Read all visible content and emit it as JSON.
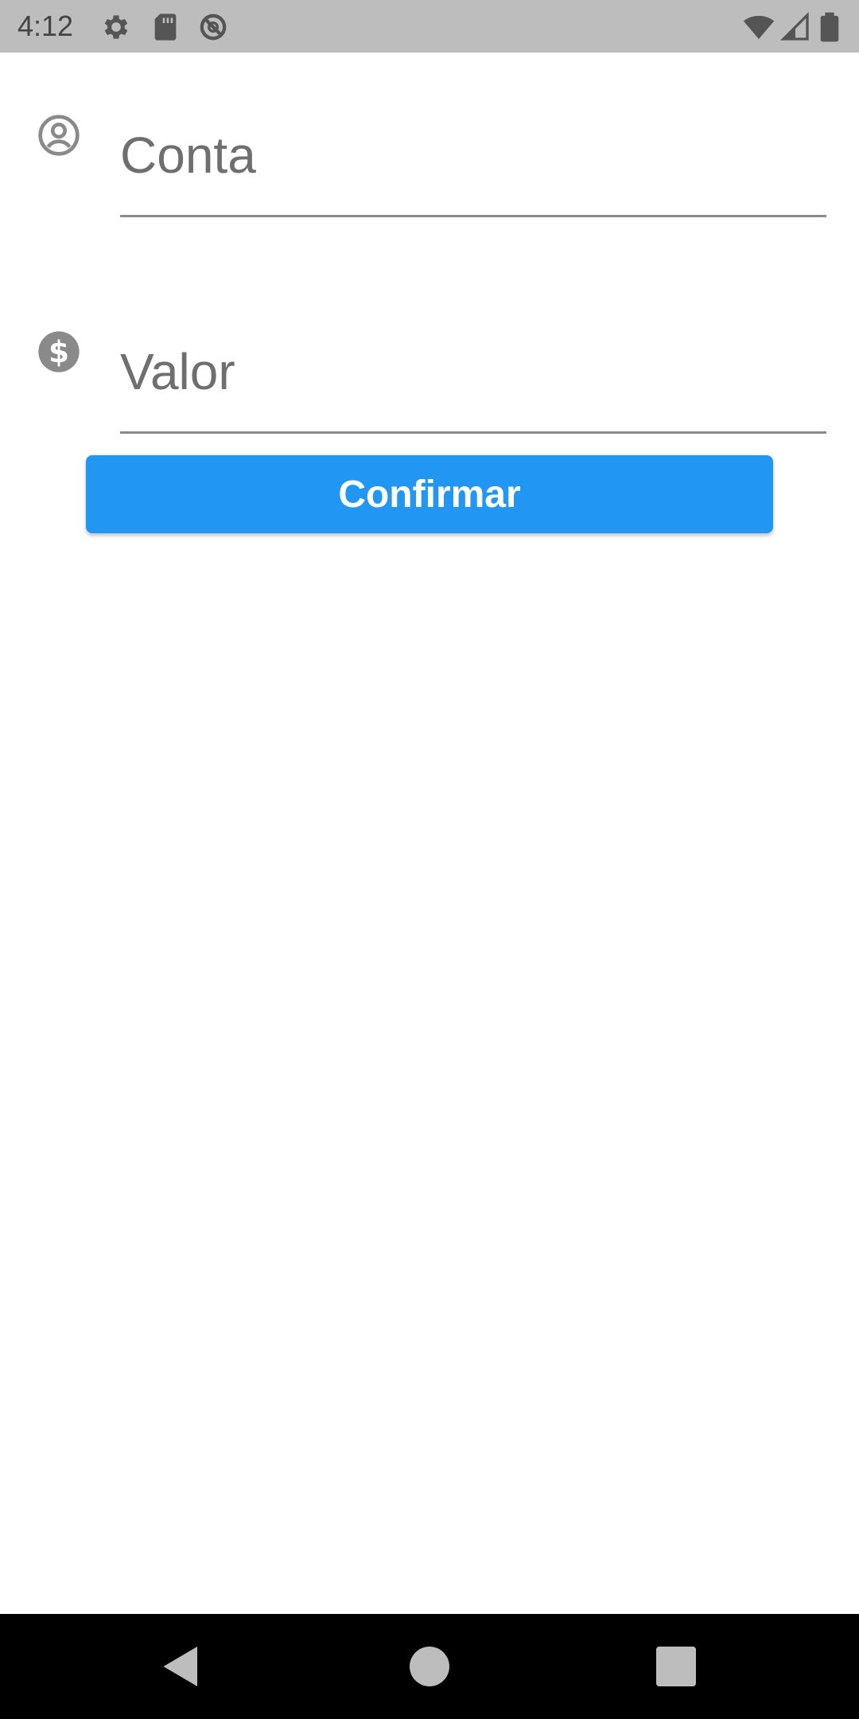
{
  "status_bar": {
    "time": "4:12",
    "left_icons": [
      "gear-icon",
      "sd-card-icon",
      "no-sync-icon"
    ],
    "right_icons": [
      "wifi-icon",
      "signal-icon",
      "battery-icon"
    ]
  },
  "form": {
    "account": {
      "icon": "account-circle-icon",
      "placeholder": "Conta",
      "value": ""
    },
    "amount": {
      "icon": "dollar-circle-icon",
      "placeholder": "Valor",
      "value": ""
    },
    "confirm_label": "Confirmar"
  },
  "colors": {
    "accent": "#2196f3",
    "status_bar": "#bdbdbd",
    "icon_gray": "#8a8a8a"
  },
  "nav_bar": {
    "buttons": [
      "back-icon",
      "home-icon",
      "recents-icon"
    ]
  }
}
